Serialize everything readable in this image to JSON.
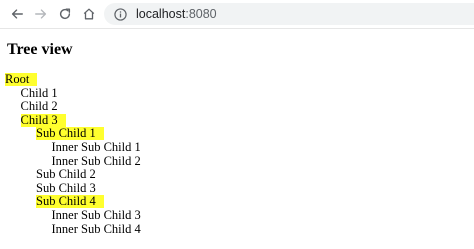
{
  "browser": {
    "url_host": "localhost",
    "url_port": ":8080",
    "icons": [
      "back-icon",
      "forward-icon",
      "reload-icon",
      "home-icon",
      "info-icon"
    ]
  },
  "page": {
    "heading": "Tree view",
    "highlight_color": "#ffff2e",
    "tree": [
      {
        "label": "Root",
        "depth": 0,
        "highlighted": true
      },
      {
        "label": "Child 1",
        "depth": 1,
        "highlighted": false
      },
      {
        "label": "Child 2",
        "depth": 1,
        "highlighted": false
      },
      {
        "label": "Child 3",
        "depth": 1,
        "highlighted": true
      },
      {
        "label": "Sub Child 1",
        "depth": 2,
        "highlighted": true
      },
      {
        "label": "Inner Sub Child 1",
        "depth": 3,
        "highlighted": false
      },
      {
        "label": "Inner Sub Child 2",
        "depth": 3,
        "highlighted": false
      },
      {
        "label": "Sub Child 2",
        "depth": 2,
        "highlighted": false
      },
      {
        "label": "Sub Child 3",
        "depth": 2,
        "highlighted": false
      },
      {
        "label": "Sub Child 4",
        "depth": 2,
        "highlighted": true
      },
      {
        "label": "Inner Sub Child 3",
        "depth": 3,
        "highlighted": false
      },
      {
        "label": "Inner Sub Child 4",
        "depth": 3,
        "highlighted": false
      }
    ]
  }
}
